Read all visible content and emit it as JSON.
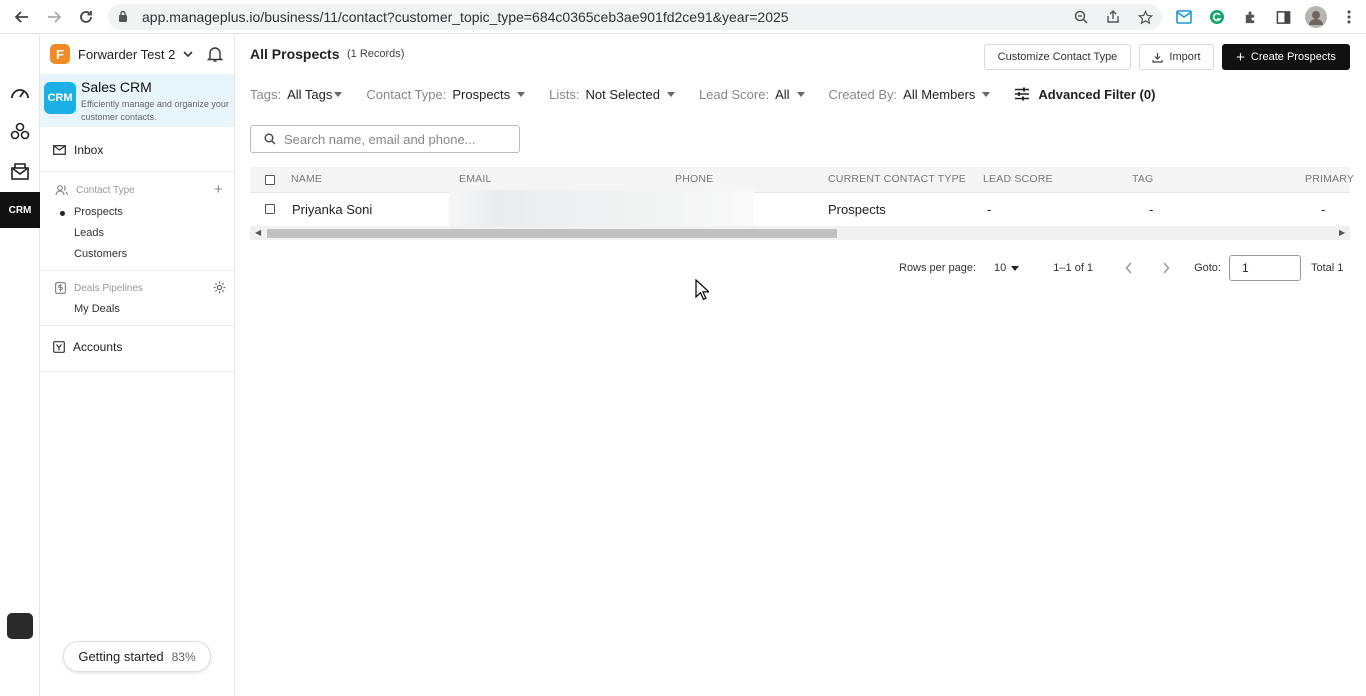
{
  "browser": {
    "url": "app.manageplus.io/business/11/contact?customer_topic_type=684c0365ceb3ae901fd2ce91&year=2025"
  },
  "org": {
    "logo_letter": "F",
    "name": "Forwarder Test 2",
    "logo_color": "#f08a24"
  },
  "product": {
    "logo_text": "CRM",
    "title": "Sales CRM",
    "description": "Efficiently manage and organize your customer contacts.",
    "accent": "#1bb0e6"
  },
  "rail": {
    "crm_label": "CRM"
  },
  "sidebar": {
    "inbox": "Inbox",
    "contact_type_title": "Contact Type",
    "contact_types": [
      "Prospects",
      "Leads",
      "Customers"
    ],
    "deals_title": "Deals Pipelines",
    "deals_items": [
      "My Deals"
    ],
    "accounts": "Accounts",
    "getting_started": "Getting started",
    "getting_started_pct": "83%"
  },
  "header": {
    "title": "All Prospects",
    "records": "(1 Records)",
    "customize_label": "Customize Contact Type",
    "import_label": "Import",
    "create_label": "Create Prospects"
  },
  "filters": {
    "tags_label": "Tags:",
    "tags_value": "All Tags",
    "contact_type_label": "Contact Type:",
    "contact_type_value": "Prospects",
    "lists_label": "Lists:",
    "lists_value": "Not Selected",
    "lead_score_label": "Lead Score:",
    "lead_score_value": "All",
    "created_by_label": "Created By:",
    "created_by_value": "All Members",
    "advanced_label": "Advanced Filter (0)"
  },
  "search": {
    "placeholder": "Search name, email and phone..."
  },
  "table": {
    "columns": [
      "NAME",
      "EMAIL",
      "PHONE",
      "CURRENT CONTACT TYPE",
      "LEAD SCORE",
      "TAG",
      "PRIMARY"
    ],
    "rows": [
      {
        "name": "Priyanka Soni",
        "email": "",
        "phone": "",
        "contact_type": "Prospects",
        "lead_score": "-",
        "tag": "-",
        "primary": "-"
      }
    ]
  },
  "pagination": {
    "rows_per_page_label": "Rows per page:",
    "rows_per_page_value": "10",
    "range": "1–1 of 1",
    "goto_label": "Goto:",
    "goto_value": "1",
    "total": "Total 1"
  }
}
